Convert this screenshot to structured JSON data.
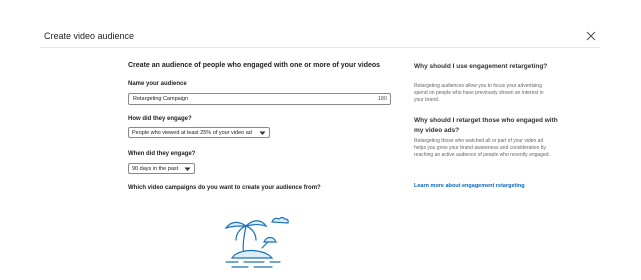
{
  "header": {
    "title": "Create video audience",
    "close_icon": "close-icon"
  },
  "form": {
    "heading": "Create an audience of people who engaged with one or more of your videos",
    "name": {
      "label": "Name your audience",
      "value": "Retargeting Campaign",
      "counter": "180"
    },
    "engage": {
      "label": "How did they engage?",
      "value": "People who viewed at least 25% of your video ad"
    },
    "when": {
      "label": "When did they engage?",
      "value": "90 days in the past"
    },
    "campaigns_label": "Which video campaigns do you want to create your audience from?"
  },
  "sidebar": {
    "q1": "Why should I use engagement retargeting?",
    "a1": "Retargeting audiences allow you to focus your advertising spend on people who have previously shown an interest in your brand.",
    "q2": "Why should I retarget those who engaged with my video ads?",
    "a2": "Retargeting those who watched all or part of your video ad helps you grow your brand awareness and consideration by reaching an active audience of people who recently engaged.",
    "link": "Learn more about engagement retargeting"
  },
  "colors": {
    "accent": "#0a66c2",
    "illustration": "#1a73b8"
  },
  "icons": {
    "chevron": "chevron-down-icon",
    "illustration": "island-illustration"
  }
}
